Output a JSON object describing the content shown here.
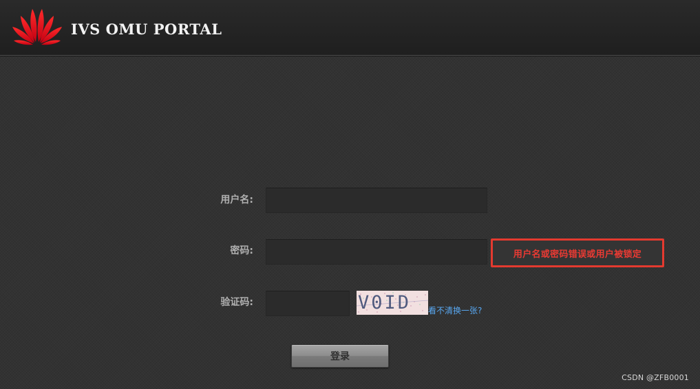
{
  "header": {
    "logo_icon": "huawei-logo",
    "title": "IVS OMU PORTAL"
  },
  "login_form": {
    "username_label": "用户名:",
    "username_value": "",
    "password_label": "密码:",
    "password_value": "",
    "error_message": "用户名或密码错误或用户被锁定",
    "captcha_label": "验证码:",
    "captcha_value": "",
    "captcha_image_text": "V0ID",
    "refresh_captcha_link": "看不清换一张?",
    "login_button": "登录"
  },
  "watermark": "CSDN @ZFB0001",
  "colors": {
    "error": "#e43a2f",
    "link": "#58a7f0",
    "logo_red": "#e4001a",
    "background": "#323232"
  }
}
